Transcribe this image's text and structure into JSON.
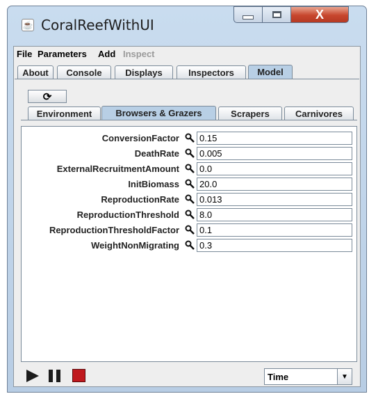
{
  "window": {
    "title": "CoralReefWithUI",
    "close_glyph": "X"
  },
  "menu": {
    "items": [
      "File",
      "Parameters",
      "Add",
      "Inspect"
    ]
  },
  "tabs": [
    "About",
    "Console",
    "Displays",
    "Inspectors",
    "Model"
  ],
  "selected_tab": "Model",
  "refresh_glyph": "⟳",
  "subtabs": [
    "Environment",
    "Browsers & Grazers",
    "Scrapers",
    "Carnivores"
  ],
  "selected_subtab": "Browsers & Grazers",
  "properties": [
    {
      "label": "ConversionFactor",
      "value": "0.15"
    },
    {
      "label": "DeathRate",
      "value": "0.005"
    },
    {
      "label": "ExternalRecruitmentAmount",
      "value": "0.0"
    },
    {
      "label": "InitBiomass",
      "value": "20.0"
    },
    {
      "label": "ReproductionRate",
      "value": "0.013"
    },
    {
      "label": "ReproductionThreshold",
      "value": "8.0"
    },
    {
      "label": "ReproductionThresholdFactor",
      "value": "0.1"
    },
    {
      "label": "WeightNonMigrating",
      "value": "0.3"
    }
  ],
  "controls": {
    "time_select_value": "Time",
    "dropdown_glyph": "▼"
  },
  "colors": {
    "stop": "#c0191e",
    "selected_tab": "#b8cfe5",
    "close": "#c7462d"
  }
}
